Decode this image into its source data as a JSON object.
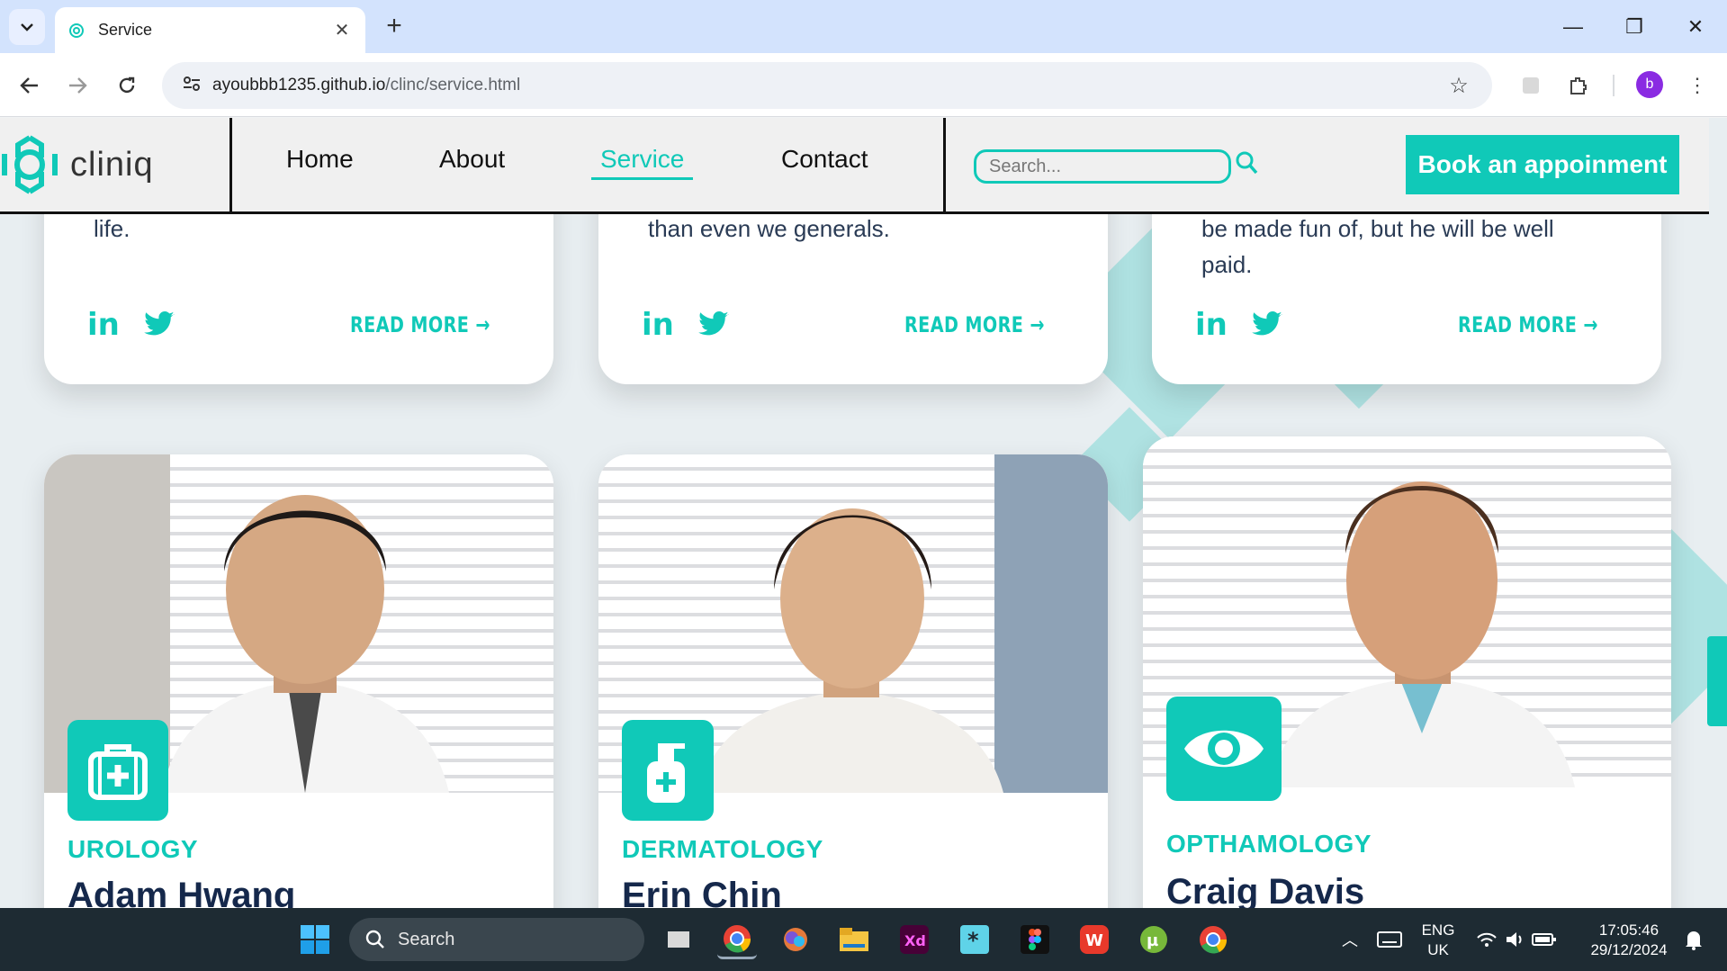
{
  "browser": {
    "tab_title": "Service",
    "url_host": "ayoubbb1235.github.io",
    "url_path": "/clinc/service.html",
    "profile_initial": "b"
  },
  "site": {
    "logo_text": "cliniq",
    "nav": [
      {
        "label": "Home"
      },
      {
        "label": "About"
      },
      {
        "label": "Service"
      },
      {
        "label": "Contact"
      }
    ],
    "search_placeholder": "Search...",
    "book_button": "Book an appoinment"
  },
  "top_cards": [
    {
      "text_lines": [
        "life."
      ],
      "read_more": "READ MORE"
    },
    {
      "text_lines": [
        "than even we generals."
      ],
      "read_more": "READ MORE"
    },
    {
      "text_lines": [
        "be made fun of, but he will be well",
        "paid."
      ],
      "read_more": "READ MORE"
    }
  ],
  "doctors": [
    {
      "specialty": "UROLOGY",
      "name": "Adam Hwang",
      "icon": "medical-kit-icon"
    },
    {
      "specialty": "DERMATOLOGY",
      "name": "Erin Chin",
      "icon": "lotion-bottle-icon"
    },
    {
      "specialty": "OPTHAMOLOGY",
      "name": "Craig Davis",
      "icon": "eye-icon"
    }
  ],
  "colors": {
    "accent": "#10c9b8",
    "dark_text": "#15284b",
    "taskbar": "#1e2b33"
  },
  "taskbar": {
    "search_label": "Search",
    "lang_line1": "ENG",
    "lang_line2": "UK",
    "time": "17:05:46",
    "date": "29/12/2024"
  }
}
